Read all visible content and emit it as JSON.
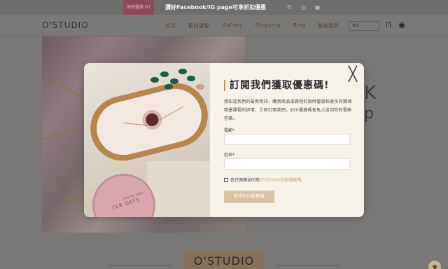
{
  "topbar": {
    "promo_tag": "限時優惠 NT",
    "promo_text": "讚好Facebook/IG page可享折扣優惠",
    "social_icons": [
      "whatsapp-icon",
      "instagram-icon",
      "facebook-icon"
    ]
  },
  "nav": {
    "logo": "O'STUDIO",
    "items": [
      {
        "label": "首頁",
        "active": true
      },
      {
        "label": "預約課程",
        "active": false
      },
      {
        "label": "Gallery",
        "active": false
      },
      {
        "label": "Shopping",
        "active": false
      },
      {
        "label": "Blog",
        "active": false
      },
      {
        "label": "聯絡我們",
        "active": false
      }
    ],
    "search_placeholder": "搜尋",
    "icons": [
      "cart-icon",
      "account-icon"
    ]
  },
  "hero": {
    "side_letter": "K",
    "side_letter2": "p"
  },
  "footer": {
    "logo": "O'STUDIO"
  },
  "modal": {
    "title": "訂閱我們獲取優惠碼!",
    "description": "想知道我們的最新資訊、購買商品或課程的限時優惠和更多有關酒精墨課程的詳情，立即訂閱我們，$50優惠碼會馬上送到你的電郵信箱。",
    "email_label": "電郵*",
    "email_value": "",
    "name_label": "姓名*",
    "name_value": "",
    "consent_text": "我已閱讀並同意",
    "consent_link": "O'STUDIO的私隱政策。",
    "submit_label": "取得$50優惠碼",
    "close_symbol": "╳",
    "image": {
      "jar_text": "TER DAYS",
      "jar_small_text": "TAKE ME AWAY"
    }
  },
  "colors": {
    "accent": "#b89a62",
    "button": "#d7c3a0",
    "modal_bg": "#f6f2ea",
    "overlay": "#7a7876"
  }
}
